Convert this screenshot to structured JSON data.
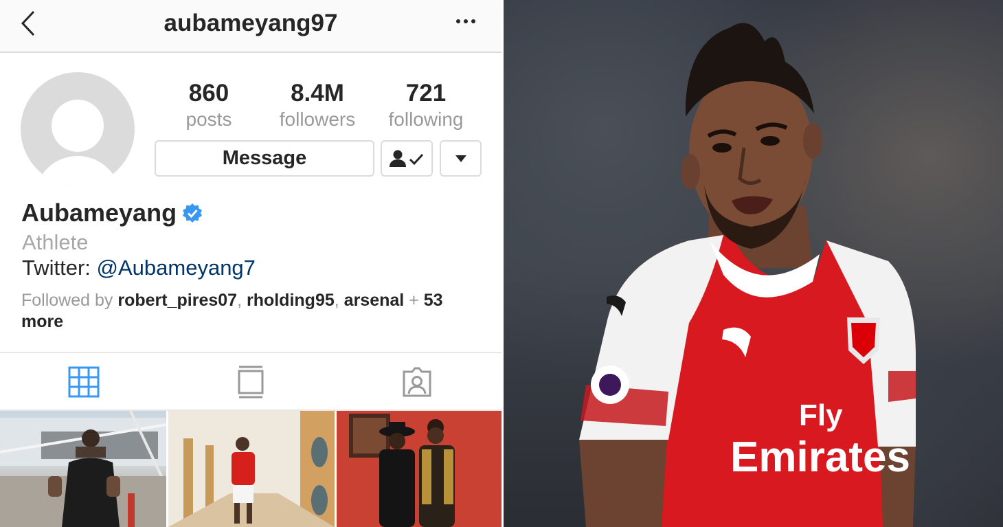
{
  "header": {
    "username": "aubameyang97"
  },
  "stats": [
    {
      "value": "860",
      "label": "posts"
    },
    {
      "value": "8.4M",
      "label": "followers"
    },
    {
      "value": "721",
      "label": "following"
    }
  ],
  "actions": {
    "message_label": "Message"
  },
  "profile": {
    "name": "Aubameyang",
    "category": "Athlete",
    "bio_prefix": "Twitter: ",
    "bio_link": "@Aubameyang7",
    "followed_by_prefix": "Followed by ",
    "followed_by_users": [
      "robert_pires07",
      "rholding95",
      "arsenal"
    ],
    "followed_by_plus": " + ",
    "followed_by_count": "53",
    "followed_by_suffix": "more"
  },
  "colors": {
    "verified": "#3897f0",
    "tab_active": "#3897f0",
    "link": "#003569",
    "arsenal_red": "#db0007"
  },
  "photo": {
    "sponsor_line1": "Fly",
    "sponsor_line2": "Emirates"
  }
}
